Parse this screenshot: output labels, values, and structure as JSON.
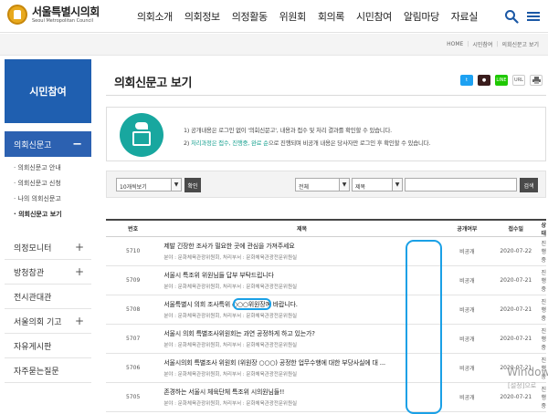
{
  "header": {
    "logo_ko": "서울특별시의회",
    "logo_en": "Seoul Metropolitan Council",
    "nav": [
      "의회소개",
      "의회정보",
      "의정활동",
      "위원회",
      "회의록",
      "시민참여",
      "알림마당",
      "자료실"
    ]
  },
  "breadcrumb": [
    "HOME",
    "시민참여",
    "의회신문고 보기"
  ],
  "sidebar": {
    "title": "시민참여",
    "active": "의회신문고",
    "sub_items": [
      "의회신문고 안내",
      "의회신문고 신청",
      "나의 의회신문고",
      "의회신문고 보기"
    ],
    "menu": [
      "의정모니터",
      "방청참관",
      "전시관대관",
      "서울의회 기고",
      "자유게시판",
      "자주묻는질문"
    ]
  },
  "page": {
    "title": "의회신문고 보기",
    "share": [
      "twitter-icon",
      "talk-icon",
      "line-icon",
      "url-icon",
      "print-icon"
    ],
    "share_url_label": "URL"
  },
  "notice": {
    "line1": "1) 공개내용은 로그인 없이 '의회신문고', 내용과 접수 및 처리 결과를 확인할 수 있습니다.",
    "line2_prefix": "2) ",
    "line2_highlight": "처리과정은 접수, 진행중, 완료 순",
    "line2_suffix": "으로 진행되며 비공개 내용은 당사자만 로그인 후 확인할 수 있습니다."
  },
  "search": {
    "page_size": "10개씩보기",
    "confirm": "확인",
    "scope": "전체",
    "field": "제목",
    "query": "",
    "submit": "검색"
  },
  "table": {
    "headers": [
      "번호",
      "제목",
      "공개여부",
      "접수일",
      "상태"
    ],
    "rows": [
      {
        "num": "5710",
        "title": "제발 긴장한 조사가 필요한 곳에 관심을 가져주세요",
        "meta": "분야 : 문화체육관광위원회, 처리부서 : 문화체육관광전문위원실",
        "open": "비공개",
        "date": "2020-07-22",
        "status": "진행중"
      },
      {
        "num": "5709",
        "title": "서울시 특조위 위원님들 답부 부탁드립니다",
        "meta": "분야 : 문화체육관광위원회, 처리부서 : 문화체육관광전문위원실",
        "open": "비공개",
        "date": "2020-07-21",
        "status": "진행중"
      },
      {
        "num": "5708",
        "title_pre": "서울특별시 의회 조사특위 ",
        "title_mark": "○○○위원장",
        "title_post": "께 바랍니다.",
        "meta": "분야 : 문화체육관광위원회, 처리부서 : 문화체육관광전문위원실",
        "open": "비공개",
        "date": "2020-07-21",
        "status": "진행중"
      },
      {
        "num": "5707",
        "title": "서울시 의회 특별조사위원회는 과연 공정하게 하고 있는가?",
        "meta": "분야 : 문화체육관광위원회, 처리부서 : 문화체육관광전문위원실",
        "open": "비공개",
        "date": "2020-07-21",
        "status": "진행중"
      },
      {
        "num": "5706",
        "title": "서울시의회 특별조사 위원회 (위원장 ○○○) 공정한 업무수행에 대한 부당사실에 대 ...",
        "meta": "분야 : 문화체육관광위원회, 처리부서 : 문화체육관광전문위원실",
        "open": "비공개",
        "date": "2020-07-21",
        "status": "진행중"
      },
      {
        "num": "5705",
        "title": "존경하는 서울시 체육단체 특조위 시의원님들!!",
        "meta": "분야 : 문화체육관광위원회, 처리부서 : 문화체육관광전문위원실",
        "open": "비공개",
        "date": "2020-07-21",
        "status": "진행중"
      }
    ]
  },
  "watermark": {
    "title": "Window",
    "sub": "[설정]으로"
  },
  "colors": {
    "brand": "#1f5fb0",
    "accent": "#18a79f",
    "highlight": "#1aa0e6"
  }
}
